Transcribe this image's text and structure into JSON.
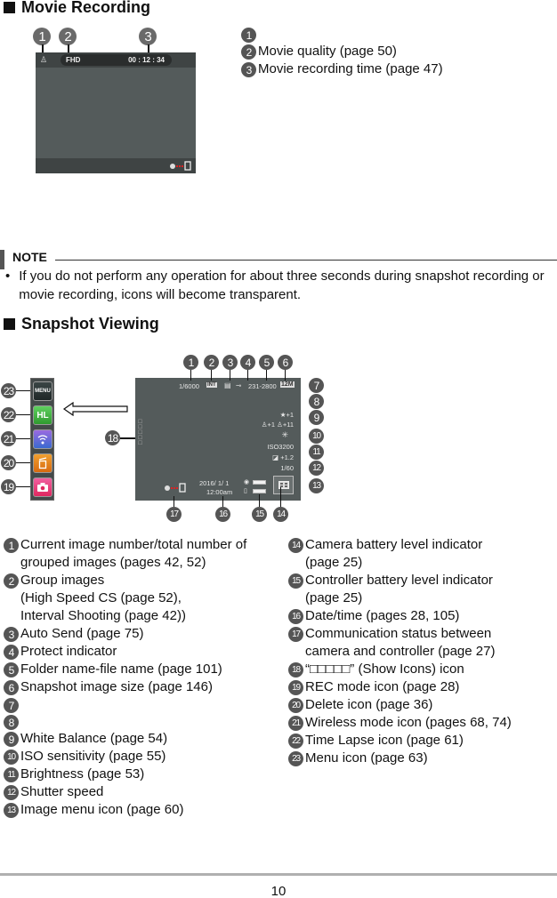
{
  "movie_section": {
    "title": "Movie Recording",
    "screen": {
      "quality": "FHD",
      "time": "00 : 12 : 34"
    },
    "callouts": [
      "1",
      "2",
      "3"
    ],
    "legend": [
      {
        "num": "1",
        "text": ""
      },
      {
        "num": "2",
        "text": "Movie quality (page 50)"
      },
      {
        "num": "3",
        "text": "Movie recording time (page 47)"
      }
    ]
  },
  "note": {
    "title": "NOTE",
    "bullet": "•",
    "text": "If you do not perform any operation for about three seconds during snapshot recording or movie recording, icons will become transparent."
  },
  "snapshot_section": {
    "title": "Snapshot Viewing",
    "sidebar": [
      {
        "num": "23",
        "label": "MENU",
        "icon": "menu-icon",
        "color": "#2f3a3a"
      },
      {
        "num": "22",
        "label": "HL",
        "icon": "time-lapse-icon",
        "color": "#3fae3f"
      },
      {
        "num": "21",
        "label": "",
        "icon": "wireless-icon",
        "color": "#6a5ad0"
      },
      {
        "num": "20",
        "label": "",
        "icon": "delete-icon",
        "color": "#e8861c"
      },
      {
        "num": "19",
        "label": "",
        "icon": "camera-icon",
        "color": "#e0306a"
      }
    ],
    "screen": {
      "image_count": "1/6000",
      "group": "INT",
      "folder_file": "231-2800",
      "size": "12M",
      "rating": "★+1",
      "faces": "♙+1  ♙+11",
      "iso": "ISO3200",
      "brightness": "+1.2",
      "shutter": "1/60",
      "date": "2016/  1/  1",
      "time": "12:00am",
      "show_icons": "□□□□□"
    },
    "top_callouts": [
      "1",
      "2",
      "3",
      "4",
      "5",
      "6"
    ],
    "right_callouts": [
      "7",
      "8",
      "9",
      "10",
      "11",
      "12",
      "13"
    ],
    "bottom_callouts": [
      "17",
      "16",
      "15",
      "14"
    ],
    "left_callout": "18",
    "legend_left": [
      {
        "num": "1",
        "text": "Current image number/total number of\ngrouped images (pages 42, 52)"
      },
      {
        "num": "2",
        "text": "Group images\n(High Speed CS (page 52),\nInterval Shooting (page 42))"
      },
      {
        "num": "3",
        "text": "Auto Send (page 75)"
      },
      {
        "num": "4",
        "text": "Protect indicator"
      },
      {
        "num": "5",
        "text": "Folder name-file name (page 101)"
      },
      {
        "num": "6",
        "text": "Snapshot image size (page 146)"
      },
      {
        "num": "7",
        "text": ""
      },
      {
        "num": "8",
        "text": ""
      },
      {
        "num": "9",
        "text": "White Balance (page 54)"
      },
      {
        "num": "10",
        "text": "ISO sensitivity (page 55)"
      },
      {
        "num": "11",
        "text": "Brightness (page 53)"
      },
      {
        "num": "12",
        "text": "Shutter speed"
      },
      {
        "num": "13",
        "text": "Image menu icon (page 60)"
      }
    ],
    "legend_right": [
      {
        "num": "14",
        "text": "Camera battery level indicator\n(page 25)"
      },
      {
        "num": "15",
        "text": "Controller battery level indicator\n(page 25)"
      },
      {
        "num": "16",
        "text": "Date/time (pages 28, 105)"
      },
      {
        "num": "17",
        "text": "Communication status between\ncamera and controller (page 27)"
      },
      {
        "num": "18",
        "text": "“□□□□□” (Show Icons) icon"
      },
      {
        "num": "19",
        "text": "REC mode icon (page 28)"
      },
      {
        "num": "20",
        "text": "Delete icon (page 36)"
      },
      {
        "num": "21",
        "text": "Wireless mode icon (pages 68, 74)"
      },
      {
        "num": "22",
        "text": "Time Lapse icon (page 61)"
      },
      {
        "num": "23",
        "text": "Menu icon (page 63)"
      }
    ]
  },
  "footer": {
    "page_number": "10"
  }
}
